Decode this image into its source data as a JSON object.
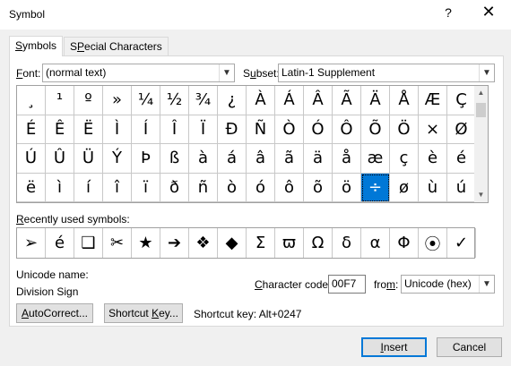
{
  "window": {
    "title": "Symbol",
    "help": "?",
    "close": "✕"
  },
  "tabs": [
    {
      "label": "Symbols",
      "underline": "S",
      "rest": "ymbols"
    },
    {
      "label": "Special Characters",
      "underline": "P",
      "pre": "S",
      "rest": "ecial Characters"
    }
  ],
  "font": {
    "label_u": "F",
    "label_rest": "ont:",
    "value": "(normal text)"
  },
  "subset": {
    "label_pre": "S",
    "label_u": "u",
    "label_rest": "bset:",
    "value": "Latin-1 Supplement"
  },
  "symbols": [
    [
      "¸",
      "¹",
      "º",
      "»",
      "¼",
      "½",
      "¾",
      "¿",
      "À",
      "Á",
      "Â",
      "Ã",
      "Ä",
      "Å",
      "Æ",
      "Ç"
    ],
    [
      "È",
      "É",
      "Ê",
      "Ë",
      "Ì",
      "Í",
      "Î",
      "Ï",
      "Ð",
      "Ñ",
      "Ò",
      "Ó",
      "Ô",
      "Õ",
      "Ö",
      "×"
    ],
    [
      "Ø",
      "Ù",
      "Ú",
      "Û",
      "Ü",
      "Ý",
      "Þ",
      "ß",
      "à",
      "á",
      "â",
      "ã",
      "ä",
      "å",
      "æ",
      "ç"
    ],
    [
      "è",
      "é",
      "ê",
      "ë",
      "ì",
      "í",
      "î",
      "ï",
      "ð",
      "ñ",
      "ò",
      "ó",
      "ô",
      "õ",
      "ö",
      "÷"
    ]
  ],
  "grid_rows_display": [
    [
      "¸",
      "¹",
      "º",
      "»",
      "¼",
      "½",
      "¾",
      "¿",
      "À",
      "Á",
      "Â",
      "Ã",
      "Ä",
      "Å",
      "Æ",
      "Ç",
      "È"
    ],
    [
      "É",
      "Ê",
      "Ë",
      "Ì",
      "Í",
      "Î",
      "Ï",
      "Ð",
      "Ñ",
      "Ò",
      "Ó",
      "Ô",
      "Õ",
      "Ö",
      "×",
      "Ø",
      "Ù"
    ],
    [
      "Ú",
      "Û",
      "Ü",
      "Ý",
      "Þ",
      "ß",
      "à",
      "á",
      "â",
      "ã",
      "ä",
      "å",
      "æ",
      "ç",
      "è",
      "é",
      "ê"
    ],
    [
      "ë",
      "ì",
      "í",
      "î",
      "ï",
      "ð",
      "ñ",
      "ò",
      "ó",
      "ô",
      "õ",
      "ö",
      "÷",
      "ø",
      "ù",
      "ú",
      "û"
    ]
  ],
  "recent": {
    "label_u": "R",
    "label_rest": "ecently used symbols:",
    "items": [
      "➢",
      "é",
      "❑",
      "✂",
      "★",
      "➔",
      "❖",
      "◆",
      "Σ",
      "ϖ",
      "Ω",
      "δ",
      "α",
      "Φ",
      "⦿",
      "✓",
      "\""
    ]
  },
  "unicode_name_label": "Unicode name:",
  "unicode_name_value": "Division Sign",
  "character_code": {
    "label_u": "C",
    "label_rest": "haracter code:",
    "value": "00F7"
  },
  "from": {
    "label_pre": "fro",
    "label_u": "m",
    "label_rest": ":",
    "value": "Unicode (hex)"
  },
  "buttons": {
    "autocorrect_u": "A",
    "autocorrect_rest": "utoCorrect...",
    "shortcut_pre": "Shortcut ",
    "shortcut_u": "K",
    "shortcut_rest": "ey...",
    "insert_u": "I",
    "insert_rest": "nsert",
    "cancel": "Cancel"
  },
  "shortcut_key_text": "Shortcut key: Alt+0247",
  "selected_symbol": "÷",
  "colors": {
    "selection": "#0078d7",
    "panel": "#ffffff",
    "dialog": "#f0f0f0"
  }
}
